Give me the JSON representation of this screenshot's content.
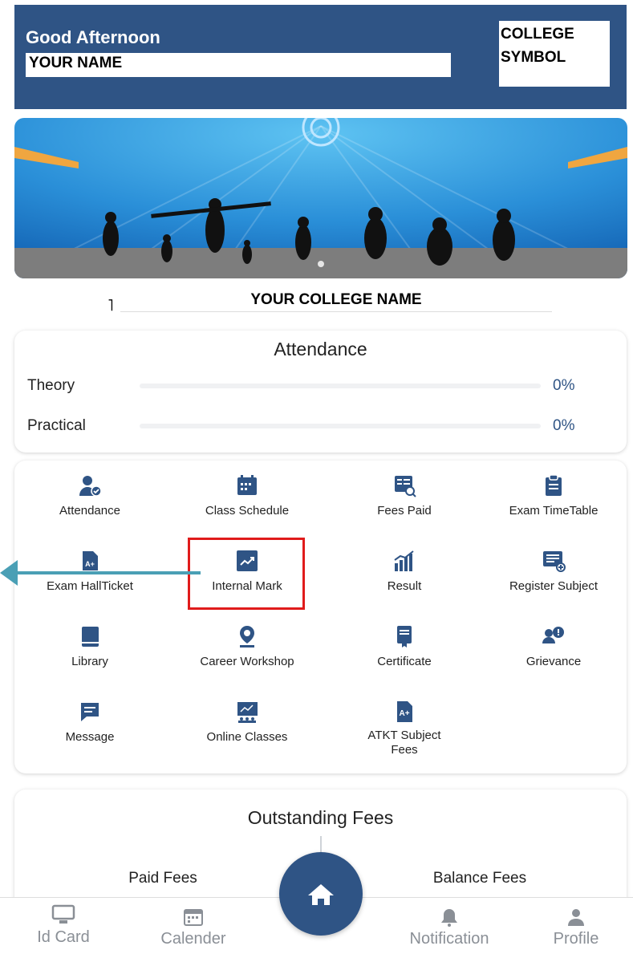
{
  "header": {
    "greeting": "Good Afternoon",
    "name": "YOUR NAME",
    "symbol_line1": "COLLEGE",
    "symbol_line2": "SYMBOL"
  },
  "college_name": "YOUR COLLEGE NAME",
  "college_mark": "˥",
  "attendance": {
    "title": "Attendance",
    "rows": [
      {
        "label": "Theory",
        "value": "0%",
        "fraction": 0
      },
      {
        "label": "Practical",
        "value": "0%",
        "fraction": 0
      }
    ]
  },
  "menu": [
    {
      "label": "Attendance",
      "icon": "user-check-icon"
    },
    {
      "label": "Class Schedule",
      "icon": "calendar-icon"
    },
    {
      "label": "Fees Paid",
      "icon": "receipt-search-icon"
    },
    {
      "label": "Exam TimeTable",
      "icon": "clipboard-icon"
    },
    {
      "label": "Exam HallTicket",
      "icon": "hallticket-icon"
    },
    {
      "label": "Internal Mark",
      "icon": "trending-icon"
    },
    {
      "label": "Result",
      "icon": "bar-chart-icon"
    },
    {
      "label": "Register Subject",
      "icon": "list-add-icon"
    },
    {
      "label": "Library",
      "icon": "book-icon"
    },
    {
      "label": "Career Workshop",
      "icon": "badge-pin-icon"
    },
    {
      "label": "Certificate",
      "icon": "certificate-icon"
    },
    {
      "label": "Grievance",
      "icon": "people-alert-icon"
    },
    {
      "label": "Message",
      "icon": "message-icon"
    },
    {
      "label": "Online Classes",
      "icon": "teacher-board-icon"
    },
    {
      "label": "ATKT Subject Fees",
      "icon": "grade-a-plus-icon"
    }
  ],
  "outstanding": {
    "title": "Outstanding Fees",
    "paid_label": "Paid Fees",
    "balance_label": "Balance Fees"
  },
  "bottom_nav": {
    "id_card": "Id Card",
    "calender": "Calender",
    "notification": "Notification",
    "profile": "Profile"
  },
  "colors": {
    "primary": "#2f5485",
    "highlight": "#e01b1b",
    "arrow": "#4a9fb5"
  }
}
